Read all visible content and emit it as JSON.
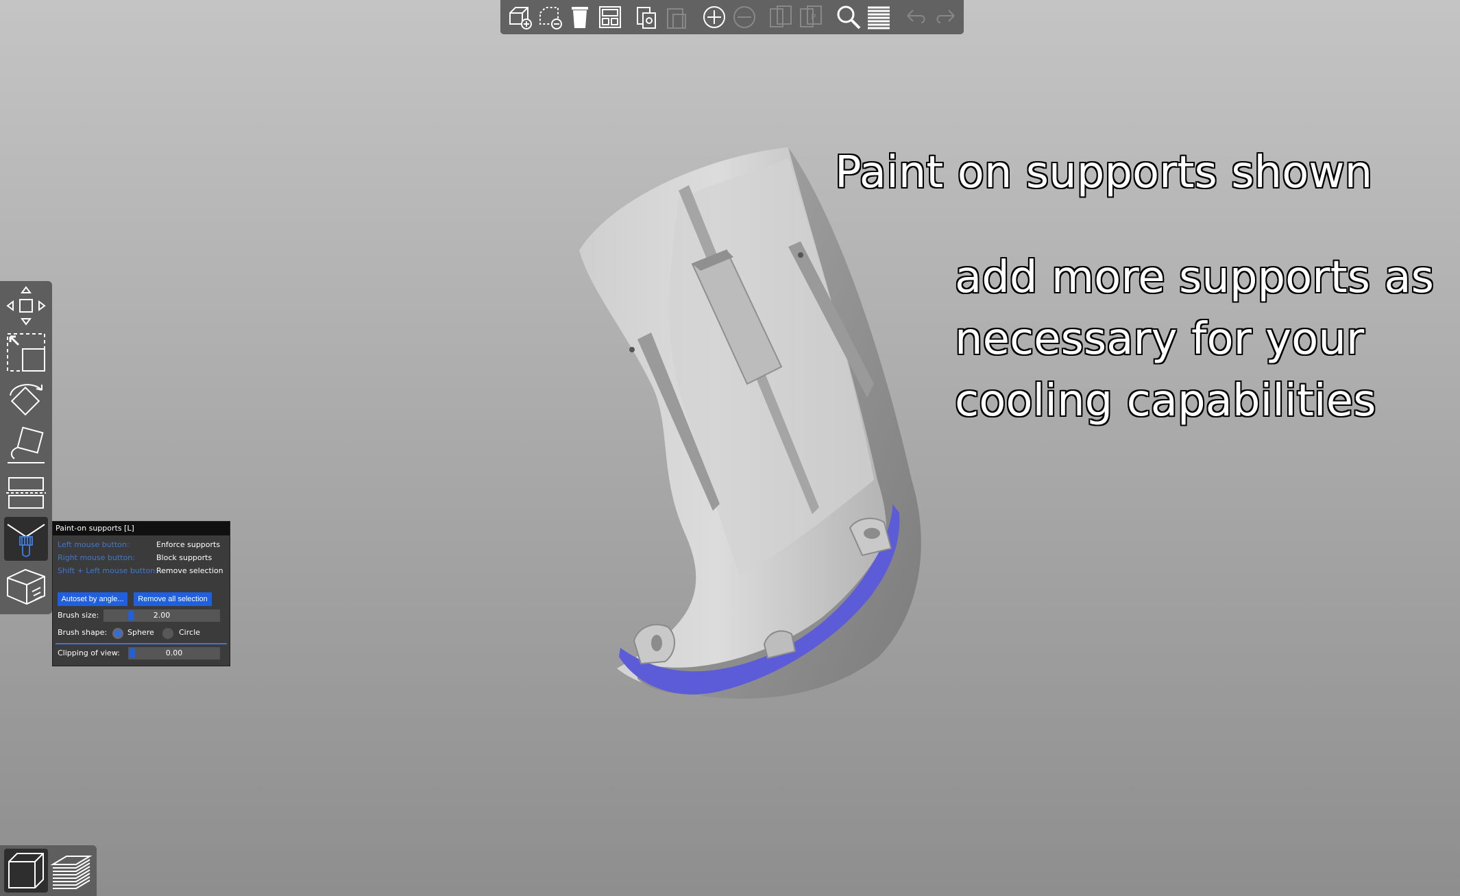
{
  "toolbar": {
    "buttons": [
      {
        "icon": "add-object-icon",
        "enabled": true
      },
      {
        "icon": "delete-object-icon",
        "enabled": true
      },
      {
        "icon": "delete-all-icon",
        "enabled": true
      },
      {
        "icon": "arrange-icon",
        "enabled": true
      },
      {
        "icon": "copy-icon",
        "enabled": true
      },
      {
        "icon": "paste-icon",
        "enabled": false
      },
      {
        "icon": "add-instance-icon",
        "enabled": true
      },
      {
        "icon": "remove-instance-icon",
        "enabled": false
      },
      {
        "icon": "split-objects-icon",
        "enabled": false
      },
      {
        "icon": "split-parts-icon",
        "enabled": false
      },
      {
        "icon": "search-icon",
        "enabled": true
      },
      {
        "icon": "layers-editing-icon",
        "enabled": true
      },
      {
        "icon": "undo-icon",
        "enabled": false
      },
      {
        "icon": "redo-icon",
        "enabled": false
      }
    ]
  },
  "left_toolbar": {
    "tools": [
      "move-icon",
      "scale-icon",
      "rotate-icon",
      "place-on-face-icon",
      "cut-icon",
      "paint-supports-icon",
      "seam-painting-icon"
    ],
    "active": "paint-supports-icon"
  },
  "paint_panel": {
    "title": "Paint-on supports [L]",
    "hints": [
      {
        "key": "Left mouse button:",
        "action": "Enforce supports"
      },
      {
        "key": "Right mouse button:",
        "action": "Block supports"
      },
      {
        "key": "Shift + Left mouse button:",
        "action": "Remove selection"
      }
    ],
    "autoset_label": "Autoset by angle...",
    "remove_all_label": "Remove all selection",
    "brush_size_label": "Brush size:",
    "brush_size_value": "2.00",
    "brush_shape_label": "Brush shape:",
    "shape_sphere": "Sphere",
    "shape_circle": "Circle",
    "selected_shape": "Sphere",
    "clipping_label": "Clipping of view:",
    "clipping_value": "0.00",
    "accent_color": "#1f5fe0",
    "hint_color": "#3f78d2"
  },
  "annotations": {
    "line1": "Paint on supports shown",
    "line2": "add more supports as",
    "line3": "necessary for your",
    "line4": "cooling capabilities"
  },
  "view_switcher": {
    "buttons": [
      "3d-view-icon",
      "preview-icon"
    ],
    "active": "3d-view-icon"
  },
  "colors": {
    "painted_support": "#5c5cd8",
    "model": "#cfcfcf",
    "toolbar_bg": "#626262"
  }
}
